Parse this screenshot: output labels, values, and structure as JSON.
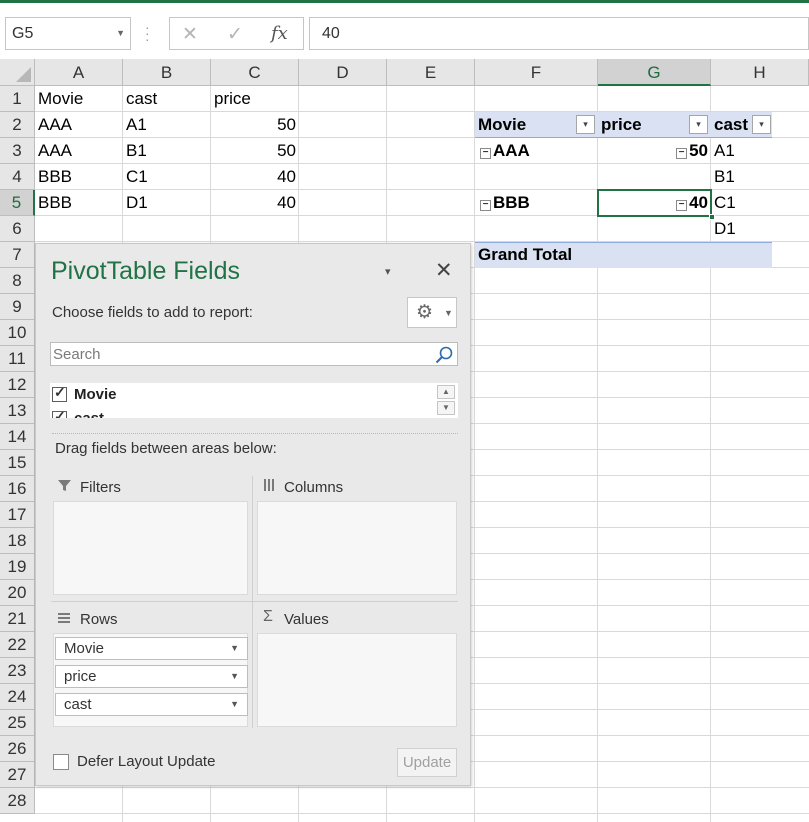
{
  "formula_bar": {
    "name_box": "G5",
    "cancel_icon": "✕",
    "enter_icon": "✓",
    "fx_icon": "fx",
    "formula": "40"
  },
  "columns": [
    "A",
    "B",
    "C",
    "D",
    "E",
    "F",
    "G",
    "H"
  ],
  "selected_column": "G",
  "rows": [
    "1",
    "2",
    "3",
    "4",
    "5",
    "6",
    "7",
    "8",
    "9",
    "10",
    "11",
    "12",
    "13",
    "14",
    "15",
    "16",
    "17",
    "18",
    "19",
    "20",
    "21",
    "22",
    "23",
    "24",
    "25",
    "26",
    "27",
    "28"
  ],
  "selected_row": "5",
  "source_table": {
    "headers": [
      "Movie",
      "cast",
      "price"
    ],
    "rows": [
      [
        "AAA",
        "A1",
        "50"
      ],
      [
        "AAA",
        "B1",
        "50"
      ],
      [
        "BBB",
        "C1",
        "40"
      ],
      [
        "BBB",
        "D1",
        "40"
      ]
    ]
  },
  "pivot": {
    "headers": [
      "Movie",
      "price",
      "cast"
    ],
    "groups": [
      {
        "movie": "AAA",
        "price": "50",
        "casts": [
          "A1",
          "B1"
        ]
      },
      {
        "movie": "BBB",
        "price": "40",
        "casts": [
          "C1",
          "D1"
        ]
      }
    ],
    "grand_total": "Grand Total",
    "collapse_symbol": "−",
    "dropdown_symbol": "▾"
  },
  "pane": {
    "title": "PivotTable Fields",
    "close": "✕",
    "menu_dropdown": "▾",
    "choose_label": "Choose fields to add to report:",
    "gear_icon": "⚙",
    "search_placeholder": "Search",
    "fields": [
      {
        "label": "Movie",
        "checked": true
      },
      {
        "label": "cast",
        "checked": true
      }
    ],
    "check_symbol": "✓",
    "drag_label": "Drag fields between areas below:",
    "areas": {
      "filters": "Filters",
      "columns": "Columns",
      "rows": "Rows",
      "values": "Values"
    },
    "row_fields": [
      "Movie",
      "price",
      "cast"
    ],
    "defer_label": "Defer Layout Update",
    "update_label": "Update"
  }
}
